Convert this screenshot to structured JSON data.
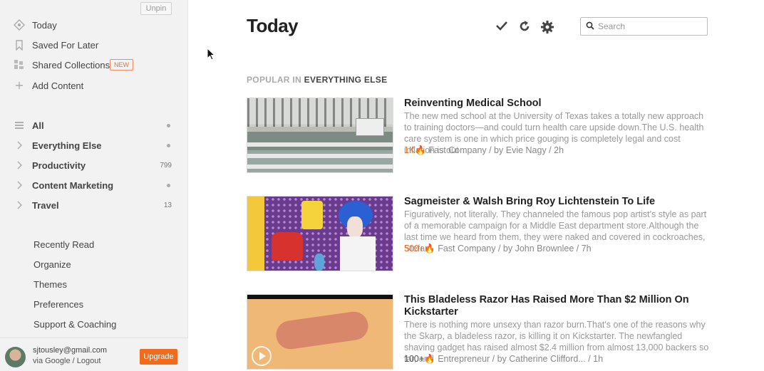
{
  "sidebar": {
    "unpin_label": "Unpin",
    "primary": [
      {
        "label": "Today",
        "icon": "today-icon"
      },
      {
        "label": "Saved For Later",
        "icon": "bookmark-icon"
      },
      {
        "label": "Shared Collections",
        "icon": "shared-collections-icon",
        "badge": "NEW"
      },
      {
        "label": "Add Content",
        "icon": "plus-icon"
      }
    ],
    "feeds": [
      {
        "label": "All",
        "icon": "list-icon",
        "indicator": "dot"
      },
      {
        "label": "Everything Else",
        "icon": "chevron-right-icon",
        "indicator": "dot"
      },
      {
        "label": "Productivity",
        "icon": "chevron-right-icon",
        "count": "799"
      },
      {
        "label": "Content Marketing",
        "icon": "chevron-right-icon",
        "indicator": "dot"
      },
      {
        "label": "Travel",
        "icon": "chevron-right-icon",
        "count": "13"
      }
    ],
    "secondary": [
      "Recently Read",
      "Organize",
      "Themes",
      "Preferences",
      "Support & Coaching"
    ],
    "account": {
      "email": "sjtousley@gmail.com",
      "via": "via Google / Logout",
      "upgrade_label": "Upgrade"
    }
  },
  "main": {
    "title": "Today",
    "toolbar": {
      "mark_read_icon": "checkmark-icon",
      "refresh_icon": "refresh-icon",
      "settings_icon": "gear-icon"
    },
    "search": {
      "placeholder": "Search",
      "value": ""
    },
    "section": {
      "prefix": "POPULAR IN",
      "category": "EVERYTHING ELSE"
    },
    "articles": [
      {
        "title": "Reinventing Medical School",
        "summary": "The new med school at the University of Texas takes a totally new approach to training doctors—and could turn health care upside down.The U.S. health care system is one in which price gouging is completely legal and cost inflation is out",
        "popularity": "1K",
        "meta": "Fast Company / by Evie Nagy / 2h"
      },
      {
        "title": "Sagmeister & Walsh Bring Roy Lichtenstein To Life",
        "summary": "Figuratively, not literally. They channeled the famous pop artist's style as part of a memorable campaign for a Middle East department store.Although the last time we heard from them, they were naked and covered in cockroaches, Stefan",
        "popularity": "500+",
        "meta": "Fast Company / by John Brownlee / 7h"
      },
      {
        "title": "This Bladeless Razor Has Raised More Than $2 Million On Kickstarter",
        "summary": "There is nothing more unsexy than razor burn.That's one of the reasons why the Skarp, a bladeless razor, is killing it on Kickstarter. The newfangled shaving gadget has raised almost $2.4 million from almost 13,000 backers so far, and",
        "popularity": "100+",
        "meta": "Entrepreneur / by Catherine Clifford... / 1h"
      }
    ]
  },
  "colors": {
    "accent": "#f26b1d",
    "sidebar_bg": "#f2f2f2"
  }
}
